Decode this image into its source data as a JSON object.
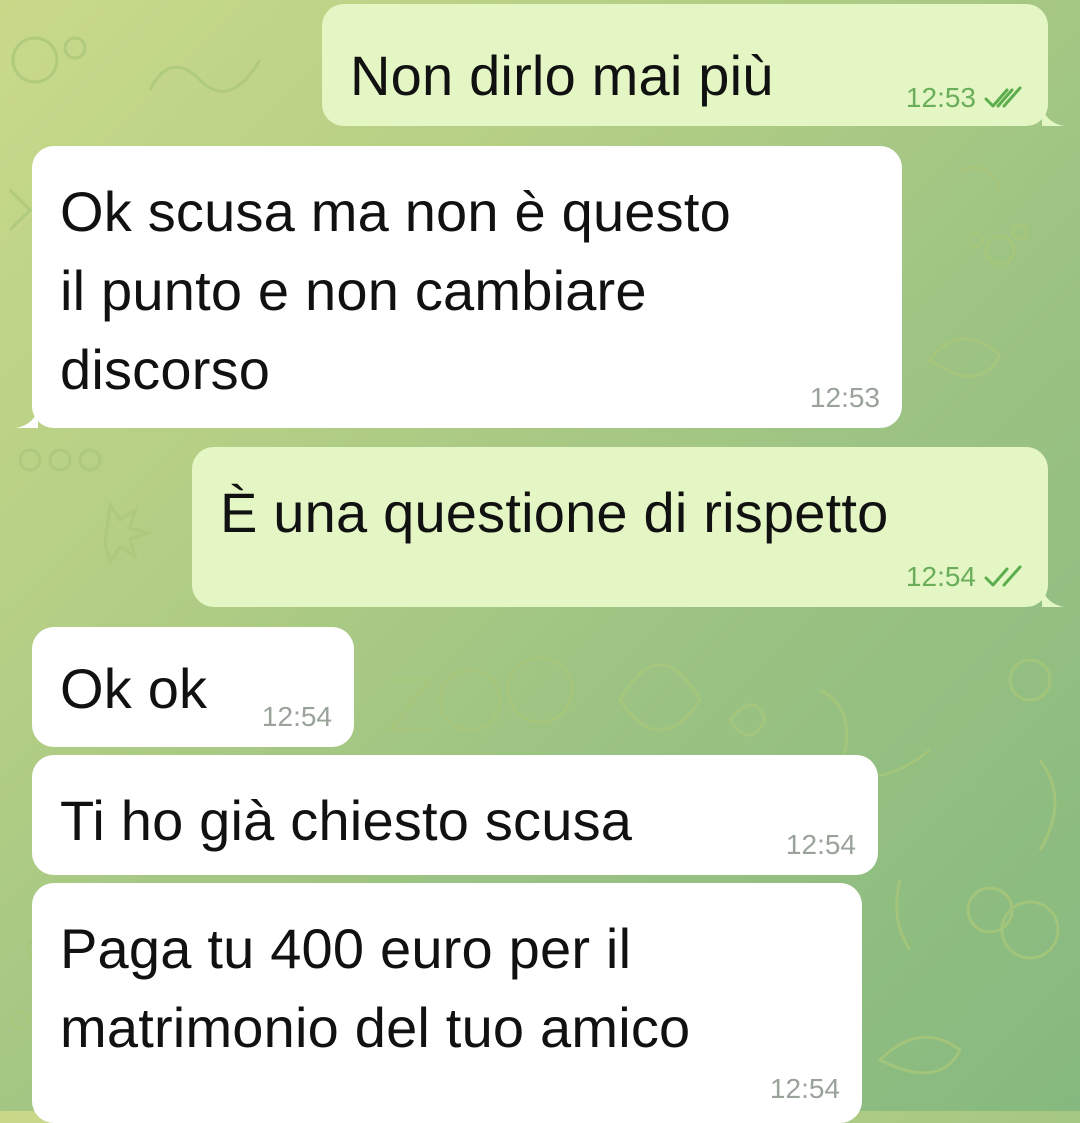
{
  "chat": {
    "messages": [
      {
        "direction": "out",
        "text": "Non dirlo mai più",
        "time": "12:53",
        "status": "read-double-check-icon"
      },
      {
        "direction": "in",
        "text": "Ok scusa ma non è questo\nil punto e non cambiare\ndiscorso",
        "time": "12:53"
      },
      {
        "direction": "out",
        "text": "È una questione di rispetto",
        "time": "12:54",
        "status": "read-double-check-icon"
      },
      {
        "direction": "in",
        "text": "Ok ok",
        "time": "12:54"
      },
      {
        "direction": "in",
        "text": "Ti ho già chiesto scusa",
        "time": "12:54"
      },
      {
        "direction": "in",
        "text": "Paga tu 400 euro per il\nmatrimonio del tuo amico",
        "time": "12:54"
      }
    ]
  },
  "colors": {
    "incoming_bubble": "#ffffff",
    "outgoing_bubble": "#e4f6c4",
    "check_marks": "#5cad4e",
    "wallpaper_start": "#c9d98a",
    "wallpaper_end": "#86b97f"
  }
}
